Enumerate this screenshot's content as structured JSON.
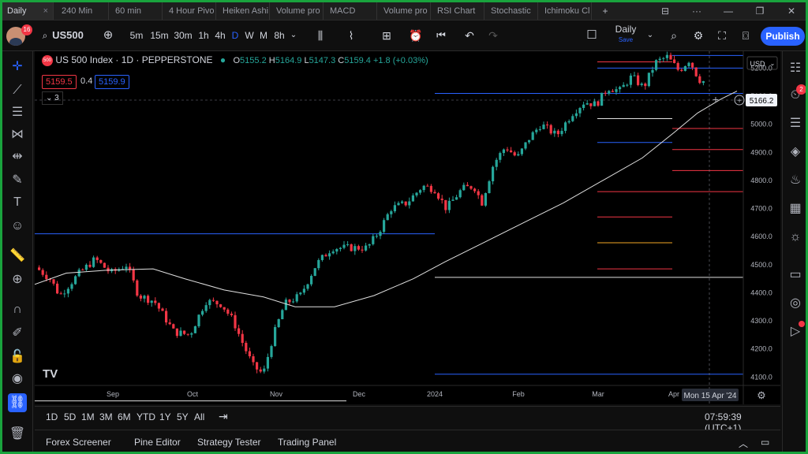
{
  "tabs": [
    "Daily",
    "240 Min",
    "60 min",
    "4 Hour Pivo",
    "Heiken Ashi",
    "Volume pro",
    "MACD",
    "Volume pro",
    "RSI Chart",
    "Stochastic",
    "Ichimoku Cl"
  ],
  "tab_close_icon": "×",
  "toolbar": {
    "badge_count": "16",
    "symbol": "US500",
    "intervals": [
      "5m",
      "15m",
      "30m",
      "1h",
      "4h",
      "D",
      "W",
      "M",
      "8h"
    ],
    "active_interval": "D",
    "layout_name": "Daily",
    "layout_status": "Save",
    "publish_label": "Publish"
  },
  "legend": {
    "logo_text": "500",
    "title": "US 500 Index · 1D · PEPPERSTONE",
    "open_label": "O",
    "open": "5155.2",
    "high_label": "H",
    "high": "5164.9",
    "low_label": "L",
    "low": "5147.3",
    "close_label": "C",
    "close": "5159.4",
    "change": "+1.8 (+0.03%)",
    "bid": "5159.5",
    "spread": "0.4",
    "ask": "5159.9",
    "indicator_count": "3"
  },
  "price_axis": {
    "currency": "USD",
    "ticks": [
      "5200.0",
      "5100.0",
      "5000.0",
      "4900.0",
      "4800.0",
      "4700.0",
      "4600.0",
      "4500.0",
      "4400.0",
      "4300.0",
      "4200.0",
      "4100.0"
    ],
    "last_price": "5166.2"
  },
  "time_axis": {
    "ticks": [
      "Sep",
      "Oct",
      "Nov",
      "Dec",
      "2024",
      "Feb",
      "Mar",
      "Apr"
    ],
    "cursor_label": "Mon 15 Apr '24"
  },
  "range_bar": {
    "ranges": [
      "1D",
      "5D",
      "1M",
      "3M",
      "6M",
      "YTD",
      "1Y",
      "5Y",
      "All"
    ],
    "clock": "07:59:39 (UTC+1)"
  },
  "bottom_panel": {
    "tabs": [
      "Forex Screener",
      "Pine Editor",
      "Strategy Tester",
      "Trading Panel"
    ]
  },
  "right_toolbar": {
    "alerts_badge": "2"
  },
  "colors": {
    "up": "#26a69a",
    "down": "#f23645",
    "accent": "#2962ff",
    "ma": "#e0e0e0",
    "frame": "#19a33d"
  },
  "icons": [
    "search-icon",
    "plus-circle-icon",
    "candles-icon",
    "indicators-icon",
    "templates-icon",
    "alert-icon",
    "replay-icon",
    "undo-icon",
    "redo-icon",
    "fullscreen-icon",
    "camera-icon",
    "settings-icon",
    "crosshair-icon",
    "trend-line-icon",
    "pitchfork-icon",
    "pattern-icon",
    "prediction-icon",
    "brush-icon",
    "text-icon",
    "emoji-icon",
    "ruler-icon",
    "zoom-icon",
    "magnet-icon",
    "lock-draw-icon",
    "lock-icon",
    "eye-icon",
    "link-icon",
    "trash-icon",
    "watchlist-icon",
    "alarm-icon",
    "news-icon",
    "layers-icon",
    "fire-icon",
    "calendar-icon",
    "bulb-icon",
    "chat-icon",
    "broadcast-icon",
    "play-icon"
  ]
}
